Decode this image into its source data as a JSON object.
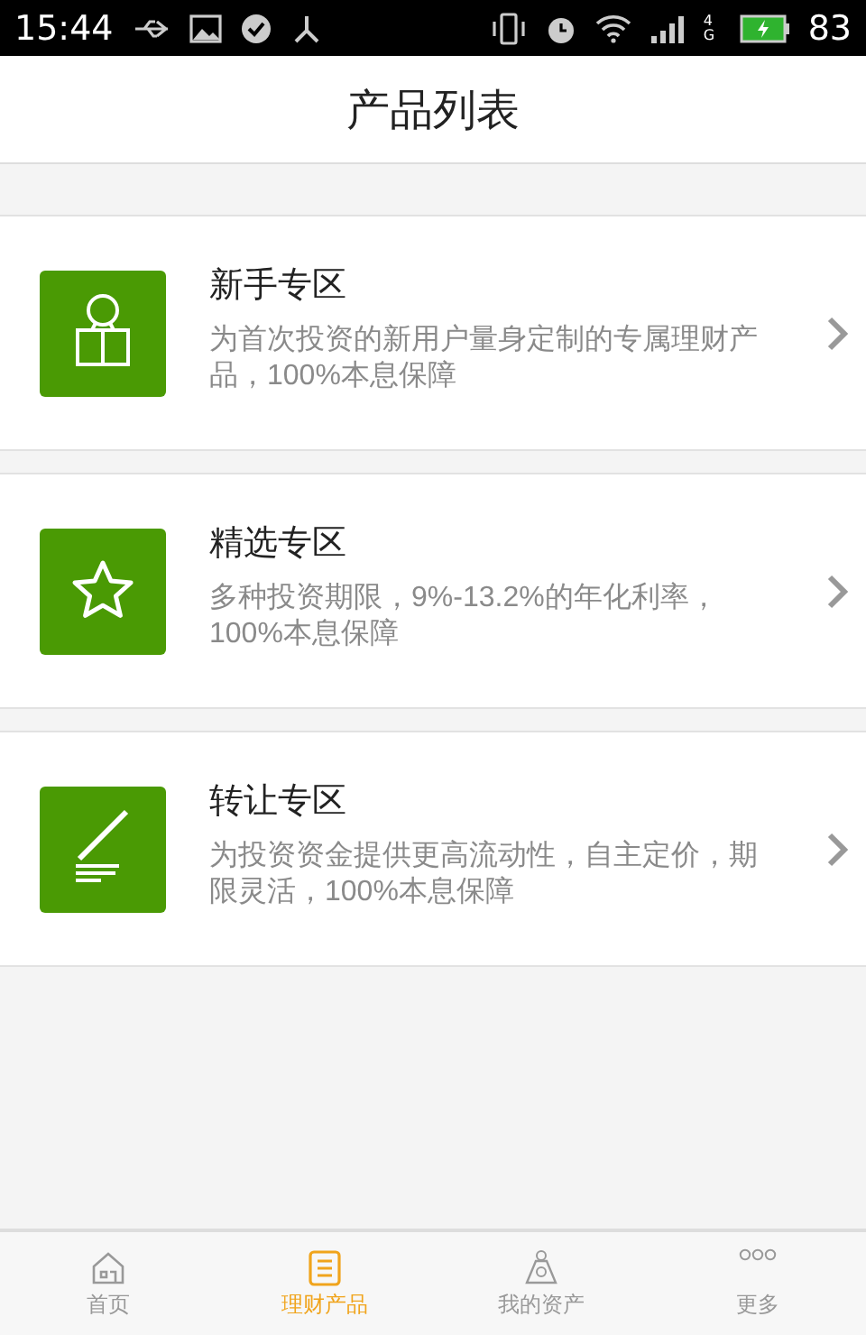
{
  "status_bar": {
    "time": "15:44",
    "network": "4G",
    "battery": "83"
  },
  "header": {
    "title": "产品列表"
  },
  "products": [
    {
      "kind": "reader",
      "title": "新手专区",
      "description": "为首次投资的新用户量身定制的专属理财产品，100%本息保障"
    },
    {
      "kind": "star",
      "title": "精选专区",
      "description": "多种投资期限，9%-13.2%的年化利率，100%本息保障"
    },
    {
      "kind": "pen",
      "title": "转让专区",
      "description": "为投资资金提供更高流动性，自主定价，期限灵活，100%本息保障"
    }
  ],
  "tabs": [
    {
      "kind": "home",
      "label": "首页",
      "selected": false
    },
    {
      "kind": "list",
      "label": "理财产品",
      "selected": true
    },
    {
      "kind": "bag",
      "label": "我的资产",
      "selected": false
    },
    {
      "kind": "more",
      "label": "更多",
      "selected": false
    }
  ]
}
